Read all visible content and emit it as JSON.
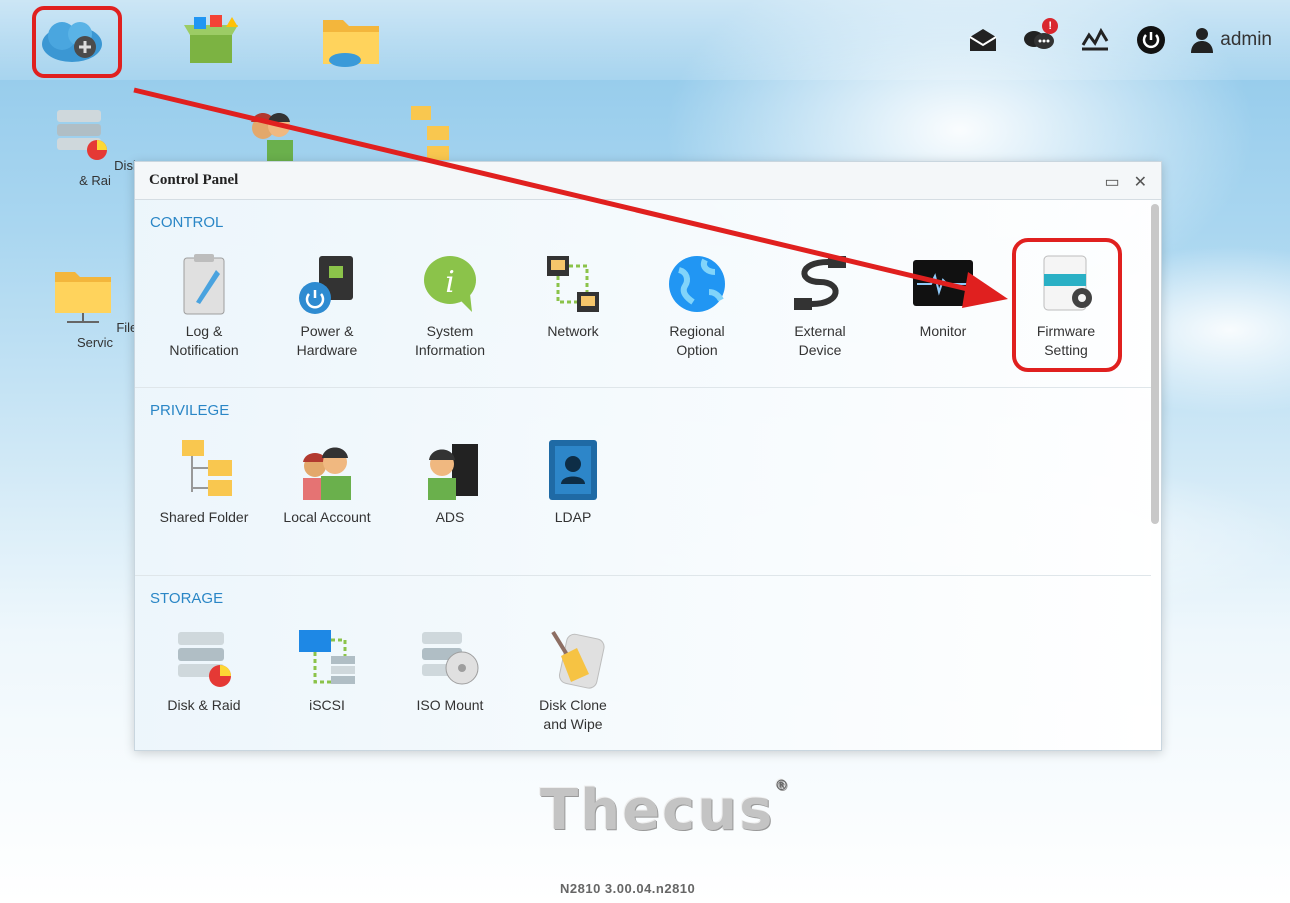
{
  "topbar": {
    "apps": [
      {
        "icon": "control-panel-cloud-icon"
      },
      {
        "icon": "app-center-icon"
      },
      {
        "icon": "file-center-icon"
      }
    ],
    "right_icons": [
      "mail-icon",
      "chat-icon",
      "monitor-graph-icon",
      "power-icon"
    ],
    "chat_badge": "!",
    "user": "admin"
  },
  "desktop": {
    "icons": [
      {
        "label": "Disk & Rai",
        "icon": "disk-raid-icon"
      },
      {
        "label": "File Servic",
        "icon": "file-service-icon"
      }
    ]
  },
  "panel": {
    "title": "Control Panel",
    "sections": [
      {
        "title": "CONTROL",
        "items": [
          {
            "label": "Log &\nNotification",
            "icon": "clipboard-icon"
          },
          {
            "label": "Power &\nHardware",
            "icon": "power-hardware-icon"
          },
          {
            "label": "System\nInformation",
            "icon": "info-icon"
          },
          {
            "label": "Network",
            "icon": "network-icon"
          },
          {
            "label": "Regional\nOption",
            "icon": "globe-icon"
          },
          {
            "label": "External\nDevice",
            "icon": "usb-cable-icon"
          },
          {
            "label": "Monitor",
            "icon": "monitor-icon"
          },
          {
            "label": "Firmware\nSetting",
            "icon": "firmware-icon"
          }
        ]
      },
      {
        "title": "PRIVILEGE",
        "items": [
          {
            "label": "Shared Folder",
            "icon": "shared-folder-icon"
          },
          {
            "label": "Local Account",
            "icon": "local-account-icon"
          },
          {
            "label": "ADS",
            "icon": "ads-icon"
          },
          {
            "label": "LDAP",
            "icon": "ldap-icon"
          }
        ]
      },
      {
        "title": "STORAGE",
        "items": [
          {
            "label": "Disk & Raid",
            "icon": "disk-raid-icon"
          },
          {
            "label": "iSCSI",
            "icon": "iscsi-icon"
          },
          {
            "label": "ISO Mount",
            "icon": "iso-mount-icon"
          },
          {
            "label": "Disk Clone\nand Wipe",
            "icon": "disk-clone-icon"
          }
        ]
      }
    ]
  },
  "brand": {
    "name": "Thecus",
    "mark": "®"
  },
  "version": "N2810   3.00.04.n2810",
  "colors": {
    "accent": "#2a86c6",
    "highlight": "#e0201f"
  }
}
